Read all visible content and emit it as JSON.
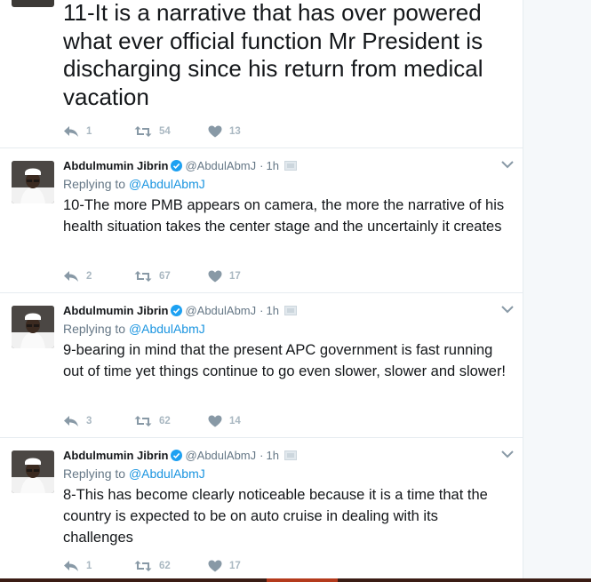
{
  "focused_tweet": {
    "text": "11-It is a narrative that has over powered what ever official function Mr President is discharging since his return from medical vacation",
    "replies": "1",
    "retweets": "54",
    "likes": "13"
  },
  "tweets": [
    {
      "name": "Abdulmumin Jibrin",
      "handle": "@AbdulAbmJ",
      "time": "1h",
      "replying_label": "Replying to",
      "replying_to": "@AbdulAbmJ",
      "text": "10-The more PMB appears on camera, the more the narrative of his health situation takes the center stage and the uncertainly it creates",
      "replies": "2",
      "retweets": "67",
      "likes": "17"
    },
    {
      "name": "Abdulmumin Jibrin",
      "handle": "@AbdulAbmJ",
      "time": "1h",
      "replying_label": "Replying to",
      "replying_to": "@AbdulAbmJ",
      "text": "9-bearing in mind that the present APC government is fast running out of time yet things continue to go even slower, slower and slower!",
      "replies": "3",
      "retweets": "62",
      "likes": "14"
    },
    {
      "name": "Abdulmumin Jibrin",
      "handle": "@AbdulAbmJ",
      "time": "1h",
      "replying_label": "Replying to",
      "replying_to": "@AbdulAbmJ",
      "text": "8-This has become clearly noticeable because it is a time that the country is expected to be on auto cruise in dealing with its challenges",
      "replies": "1",
      "retweets": "62",
      "likes": "17"
    }
  ],
  "icons": {
    "reply": "reply-icon",
    "retweet": "retweet-icon",
    "like": "heart-icon",
    "verified": "verified-badge-icon",
    "media": "media-photo-icon",
    "caret": "chevron-down-icon"
  },
  "colors": {
    "link": "#1b95e0",
    "verified": "#1da1f2",
    "muted": "#657786",
    "action": "#8899a6"
  }
}
